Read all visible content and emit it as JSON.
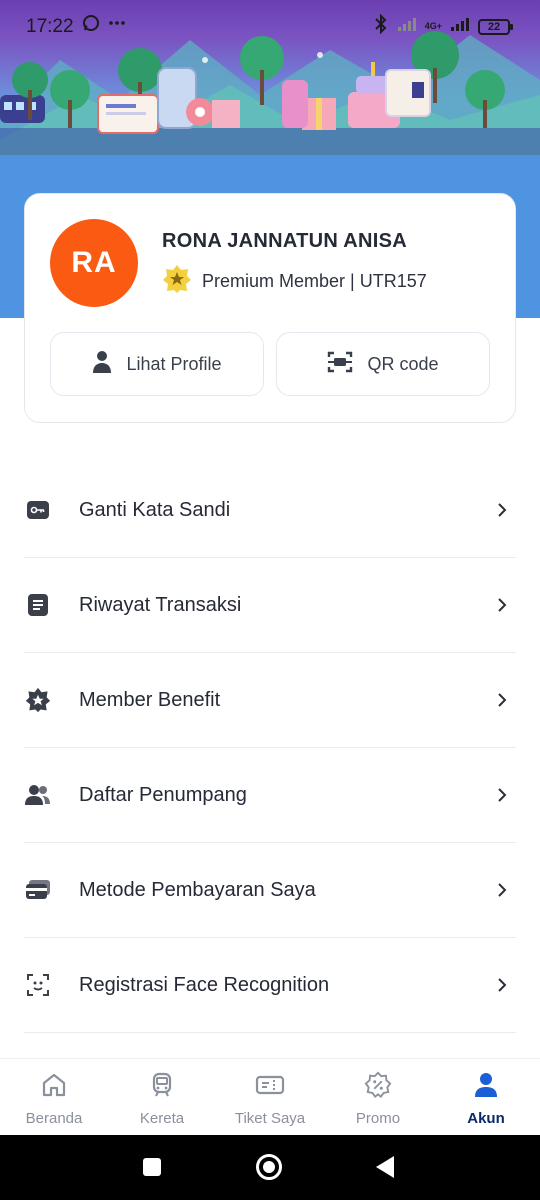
{
  "status_bar": {
    "time": "17:22",
    "network": "4G+",
    "battery": "22",
    "icons": [
      "whatsapp-icon",
      "more-icon",
      "bluetooth-icon",
      "signal-icon",
      "battery-icon"
    ]
  },
  "profile": {
    "initials": "RA",
    "name": "RONA JANNATUN ANISA",
    "membership": "Premium Member | UTR157",
    "avatar_color": "#fb5a12",
    "actions": {
      "view_profile": "Lihat Profile",
      "qr_code": "QR code"
    }
  },
  "menu": {
    "items": [
      {
        "label": "Ganti Kata Sandi",
        "icon": "key-icon"
      },
      {
        "label": "Riwayat Transaksi",
        "icon": "document-icon"
      },
      {
        "label": "Member Benefit",
        "icon": "badge-star-icon"
      },
      {
        "label": "Daftar Penumpang",
        "icon": "users-icon"
      },
      {
        "label": "Metode Pembayaran Saya",
        "icon": "card-icon"
      },
      {
        "label": "Registrasi Face Recognition",
        "icon": "face-scan-icon"
      }
    ]
  },
  "bottom_nav": {
    "items": [
      {
        "label": "Beranda",
        "icon": "home-icon",
        "active": false
      },
      {
        "label": "Kereta",
        "icon": "train-icon",
        "active": false
      },
      {
        "label": "Tiket Saya",
        "icon": "ticket-icon",
        "active": false
      },
      {
        "label": "Promo",
        "icon": "discount-icon",
        "active": false
      },
      {
        "label": "Akun",
        "icon": "user-icon",
        "active": true
      }
    ],
    "active_color": "#0b2a6b",
    "inactive_color": "#8a909c"
  },
  "colors": {
    "brand_blue": "#1b5fd6",
    "text_dark": "#262a36",
    "divider": "#e8ecf1"
  }
}
